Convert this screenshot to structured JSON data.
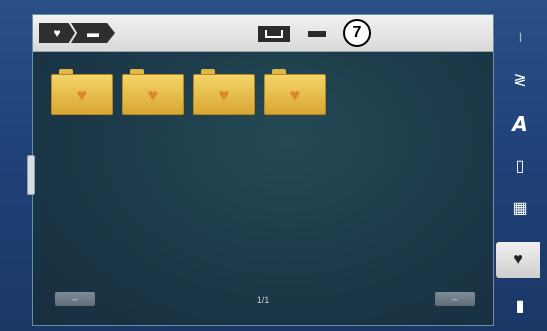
{
  "topbar": {
    "breadcrumb": [
      {
        "icon": "heart-icon",
        "glyph": "♥"
      },
      {
        "icon": "folder-icon",
        "glyph": "▬"
      }
    ],
    "marker_label": "7"
  },
  "folders": [
    {
      "icon": "heart-icon",
      "glyph": "♥"
    },
    {
      "icon": "heart-icon",
      "glyph": "♥"
    },
    {
      "icon": "heart-icon",
      "glyph": "♥"
    },
    {
      "icon": "heart-icon",
      "glyph": "♥"
    }
  ],
  "footer": {
    "prev_label": "–",
    "page_indicator": "1/1",
    "next_label": "–"
  },
  "sidebar": {
    "items": [
      {
        "icon": "stitch-pattern-icon",
        "glyph": "⦚",
        "active": false
      },
      {
        "icon": "zigzag-stitch-icon",
        "glyph": "≷",
        "active": false
      },
      {
        "icon": "alphabet-icon",
        "glyph": "A",
        "active": false
      },
      {
        "icon": "buttonhole-icon",
        "glyph": "▯",
        "active": false
      },
      {
        "icon": "quilt-stitch-icon",
        "glyph": "▦",
        "active": false
      },
      {
        "icon": "heart-icon",
        "glyph": "♥",
        "active": true
      },
      {
        "icon": "file-icon",
        "glyph": "▮",
        "active": false
      }
    ]
  },
  "colors": {
    "accent": "#f4d46a",
    "background": "#1d3b4a",
    "frame": "#2a4f86"
  }
}
